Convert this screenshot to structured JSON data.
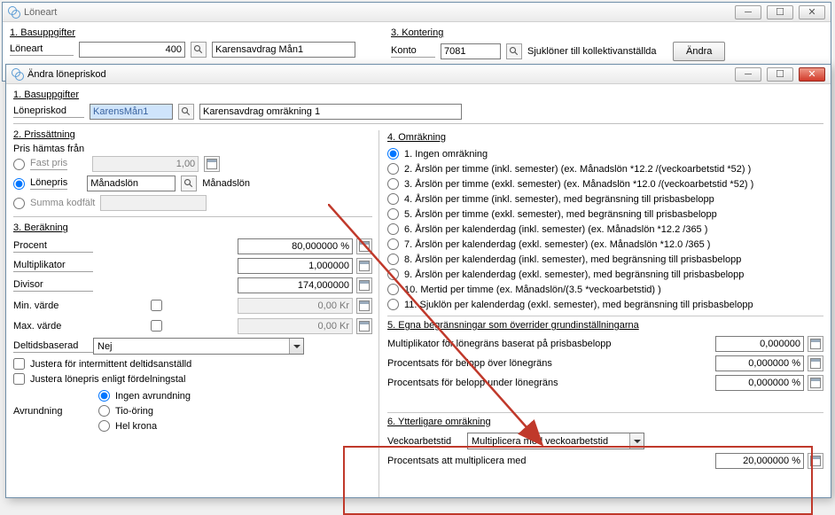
{
  "win1": {
    "title": "Löneart",
    "sect1": "1. Basuppgifter",
    "loneart_lbl": "Löneart",
    "loneart_val": "400",
    "loneart_desc": "Karensavdrag Mån1",
    "sect3": "3. Kontering",
    "konto_lbl": "Konto",
    "konto_val": "7081",
    "konto_desc": "Sjuklöner till kollektivanställda",
    "andra_btn": "Ändra"
  },
  "win2": {
    "title": "Ändra lönepriskod",
    "sect1": "1. Basuppgifter",
    "lonepriskod_lbl": "Lönepriskod",
    "lonepriskod_val": "KarensMån1",
    "lonepriskod_desc": "Karensavdrag omräkning 1",
    "sect2": "2. Prissättning",
    "pris_hamtas": "Pris hämtas från",
    "fastpris": "Fast pris",
    "fastpris_val": "1,00",
    "lonepris": "Lönepris",
    "lonepris_val": "Månadslön",
    "lonepris_desc": "Månadslön",
    "summa_kodfalt": "Summa kodfält",
    "sect3": "3. Beräkning",
    "procent_lbl": "Procent",
    "procent_val": "80,000000 %",
    "mult_lbl": "Multiplikator",
    "mult_val": "1,000000",
    "div_lbl": "Divisor",
    "div_val": "174,000000",
    "min_lbl": "Min. värde",
    "min_val": "0,00 Kr",
    "max_lbl": "Max. värde",
    "max_val": "0,00 Kr",
    "deltid_lbl": "Deltidsbaserad",
    "deltid_val": "Nej",
    "justera1": "Justera för intermittent deltidsanställd",
    "justera2": "Justera lönepris enligt fördelningstal",
    "avrundning_lbl": "Avrundning",
    "avr1": "Ingen avrundning",
    "avr2": "Tio-öring",
    "avr3": "Hel krona",
    "sect4": "4. Omräkning",
    "omr1": "1. Ingen omräkning",
    "omr2": "2. Årslön per timme (inkl. semester)  (ex. Månadslön *12.2 /(veckoarbetstid *52) )",
    "omr3": "3. Årslön per timme (exkl. semester)  (ex. Månadslön *12.0 /(veckoarbetstid *52) )",
    "omr4": "4. Årslön per timme (inkl. semester), med begränsning till prisbasbelopp",
    "omr5": "5. Årslön per timme (exkl. semester), med begränsning till prisbasbelopp",
    "omr6": "6. Årslön per kalenderdag (inkl. semester)  (ex. Månadslön *12.2 /365 )",
    "omr7": "7. Årslön per kalenderdag (exkl. semester)  (ex. Månadslön *12.0 /365 )",
    "omr8": "8. Årslön per kalenderdag (inkl. semester), med begränsning till prisbasbelopp",
    "omr9": "9. Årslön per kalenderdag (exkl. semester), med begränsning till prisbasbelopp",
    "omr10": "10. Mertid per timme (ex. Månadslön/(3.5 *veckoarbetstid) )",
    "omr11": "11. Sjuklön per kalenderdag (exkl. semester), med begränsning till prisbasbelopp",
    "sect5": "5. Egna begränsningar som överrider grundinställningarna",
    "eg1_lbl": "Multiplikator för lönegräns baserat på prisbasbelopp",
    "eg1_val": "0,000000",
    "eg2_lbl": "Procentsats för belopp över lönegräns",
    "eg2_val": "0,000000 %",
    "eg3_lbl": "Procentsats för belopp under lönegräns",
    "eg3_val": "0,000000 %",
    "sect6": "6. Ytterligare omräkning",
    "vecko_lbl": "Veckoarbetstid",
    "vecko_val": "Multiplicera med veckoarbetstid",
    "procsats_lbl": "Procentsats att multiplicera med",
    "procsats_val": "20,000000 %"
  },
  "icons": {
    "min": "─",
    "max": "☐",
    "close": "✕"
  }
}
